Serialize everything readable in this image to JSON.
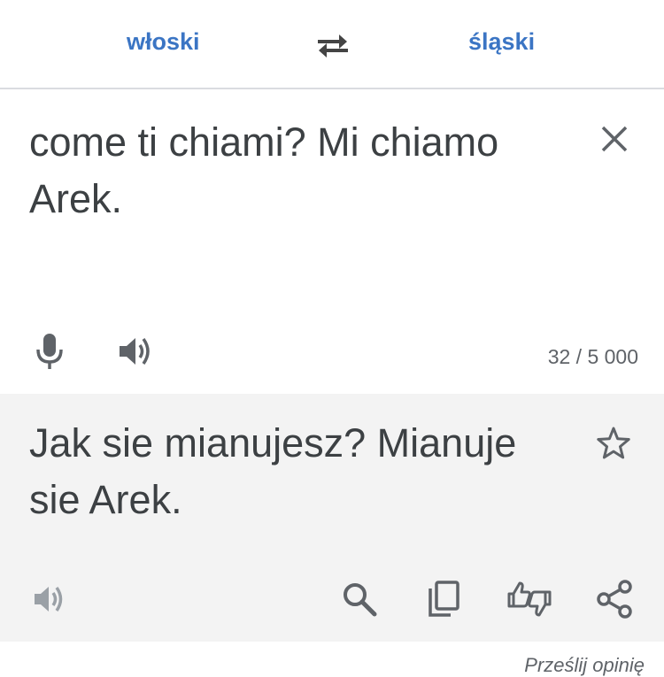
{
  "header": {
    "source_language": "włoski",
    "target_language": "śląski",
    "swap_icon": "swap-arrows-icon"
  },
  "input": {
    "text": "come ti chiami? Mi chiamo Arek.",
    "char_count": "32 / 5 000",
    "icons": [
      "close-icon",
      "microphone-icon",
      "speaker-icon"
    ]
  },
  "output": {
    "text": "Jak sie mianujesz? Mianuje sie Arek.",
    "icons": [
      "star-icon",
      "speaker-icon",
      "search-icon",
      "copy-icon",
      "feedback-icon",
      "share-icon"
    ]
  },
  "footer": {
    "feedback_link": "Prześlij opinię"
  },
  "colors": {
    "accent": "#3b75c4",
    "text": "#3c4043",
    "icon": "#5f6368",
    "output_background": "#f3f3f3"
  }
}
